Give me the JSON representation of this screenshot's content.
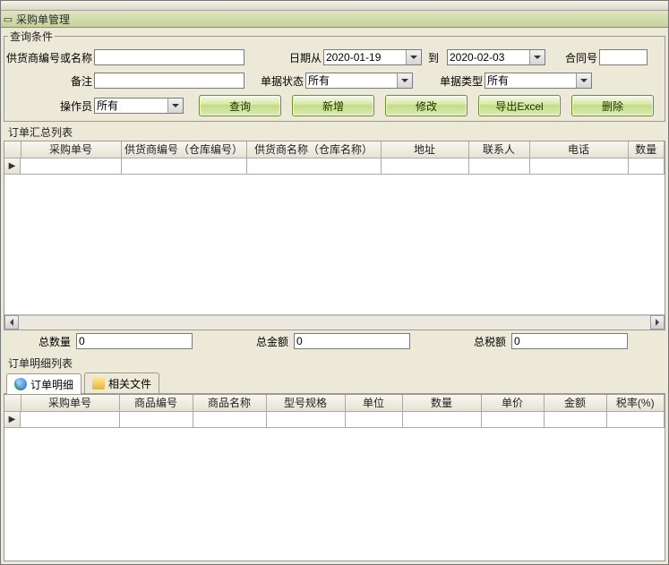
{
  "window": {
    "title": "采购单管理"
  },
  "query": {
    "group_title": "查询条件",
    "supplier_label": "供货商编号或名称",
    "supplier_value": "",
    "date_label": "日期从",
    "date_from": "2020-01-19",
    "date_to_label": "到",
    "date_to": "2020-02-03",
    "contract_label": "合同号",
    "contract_value": "",
    "remark_label": "备注",
    "remark_value": "",
    "status_label": "单据状态",
    "status_value": "所有",
    "type_label": "单据类型",
    "type_value": "所有",
    "operator_label": "操作员",
    "operator_value": "所有"
  },
  "buttons": {
    "query": "查询",
    "add": "新增",
    "edit": "修改",
    "export": "导出Excel",
    "delete": "删除"
  },
  "summary": {
    "title": "订单汇总列表",
    "columns": [
      "采购单号",
      "供货商编号（仓库编号）",
      "供货商名称（仓库名称）",
      "地址",
      "联系人",
      "电话",
      "数量"
    ]
  },
  "totals": {
    "qty_label": "总数量",
    "qty_value": "0",
    "amount_label": "总金额",
    "amount_value": "0",
    "tax_label": "总税额",
    "tax_value": "0"
  },
  "detail": {
    "title": "订单明细列表",
    "tab_detail": "订单明细",
    "tab_files": "相关文件",
    "columns": [
      "采购单号",
      "商品编号",
      "商品名称",
      "型号规格",
      "单位",
      "数量",
      "单价",
      "金额",
      "税率(%)"
    ]
  }
}
